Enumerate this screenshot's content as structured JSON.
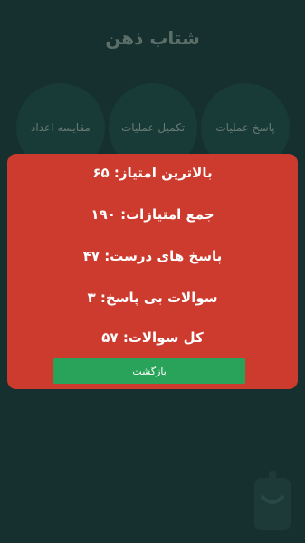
{
  "app": {
    "title": "شتاب ذهن"
  },
  "menu": {
    "items": [
      {
        "label": "پاسخ عملیات"
      },
      {
        "label": "تکمیل عملیات"
      },
      {
        "label": "مقایسه اعداد"
      }
    ]
  },
  "dialog": {
    "best_score": "بالاترین امتیاز: ۶۵",
    "total_score": "جمع امتیازات: ۱۹۰",
    "correct_answers": "پاسخ های درست: ۴۷",
    "unanswered": "سوالات بی پاسخ: ۳",
    "total_questions": "کل سوالات: ۵۷",
    "back_label": "بازگشت"
  },
  "colors": {
    "background": "#16302f",
    "dialog": "#cd3b2e",
    "button": "#29a35a"
  }
}
